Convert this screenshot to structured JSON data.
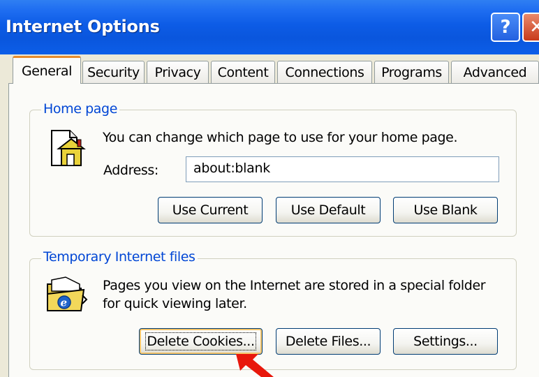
{
  "window": {
    "title": "Internet Options",
    "help_label": "?",
    "close_label": "✕"
  },
  "tabs": [
    {
      "label": "General",
      "active": true
    },
    {
      "label": "Security"
    },
    {
      "label": "Privacy"
    },
    {
      "label": "Content"
    },
    {
      "label": "Connections"
    },
    {
      "label": "Programs"
    },
    {
      "label": "Advanced"
    }
  ],
  "home_page": {
    "legend": "Home page",
    "description": "You can change which page to use for your home page.",
    "address_label": "Address:",
    "address_value": "about:blank",
    "buttons": {
      "use_current": "Use Current",
      "use_default": "Use Default",
      "use_blank": "Use Blank"
    }
  },
  "temp_files": {
    "legend": "Temporary Internet files",
    "description_line1": "Pages you view on the Internet are stored in a special folder",
    "description_line2": "for quick viewing later.",
    "buttons": {
      "delete_cookies": "Delete Cookies...",
      "delete_files": "Delete Files...",
      "settings": "Settings..."
    }
  },
  "colors": {
    "title_bar": "#0a56dd",
    "legend_text": "#0046d5",
    "active_tab_highlight": "#e68b2c",
    "pointer_arrow": "#e8180c"
  },
  "icons": [
    "home-page-icon",
    "temp-files-folder-icon",
    "pointer-arrow-icon"
  ]
}
